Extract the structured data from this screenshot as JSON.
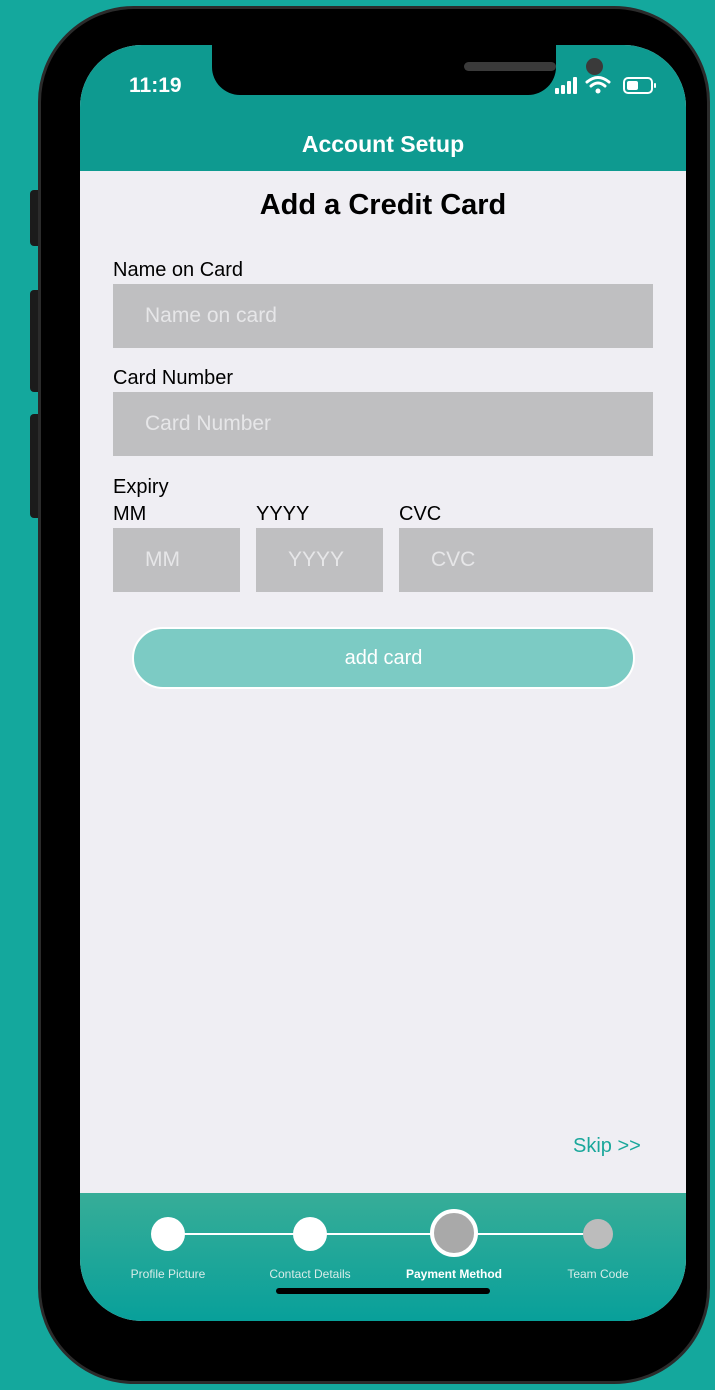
{
  "status_bar": {
    "time": "11:19"
  },
  "header": {
    "title": "Account Setup"
  },
  "form": {
    "title": "Add a Credit Card",
    "name_on_card": {
      "label": "Name on Card",
      "placeholder": "Name on card",
      "value": ""
    },
    "card_number": {
      "label": "Card Number",
      "placeholder": "Card Number",
      "value": ""
    },
    "expiry": {
      "label": "Expiry",
      "month": {
        "label": "MM",
        "placeholder": "MM",
        "value": ""
      },
      "year": {
        "label": "YYYY",
        "placeholder": "YYYY",
        "value": ""
      }
    },
    "cvc": {
      "label": "CVC",
      "placeholder": "CVC",
      "value": ""
    },
    "submit_label": "add card"
  },
  "skip_label": "Skip >>",
  "progress": {
    "steps": [
      {
        "label": "Profile Picture",
        "state": "done"
      },
      {
        "label": "Contact Details",
        "state": "done"
      },
      {
        "label": "Payment Method",
        "state": "current"
      },
      {
        "label": "Team Code",
        "state": "todo"
      }
    ]
  },
  "colors": {
    "brand": "#0e9a90",
    "background": "#14a89d",
    "button": "#7ccbc4",
    "input": "#bfbfc1",
    "screen": "#efeef3"
  },
  "icons": [
    "signal-icon",
    "wifi-icon",
    "battery-icon"
  ]
}
